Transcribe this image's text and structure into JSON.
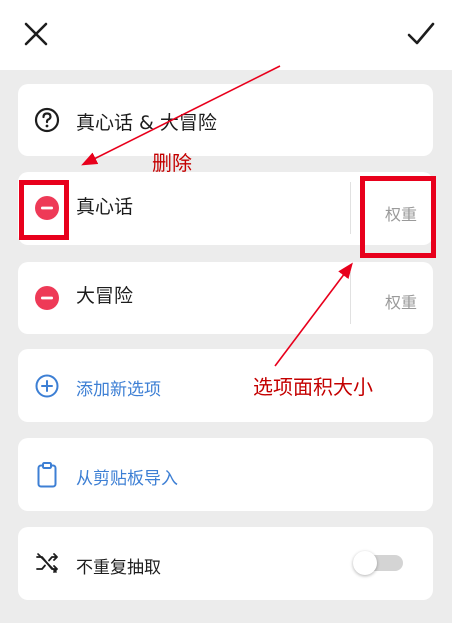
{
  "header": {
    "close_icon": "close-icon",
    "confirm_icon": "check-icon"
  },
  "title_card": {
    "icon": "question-circle-icon",
    "text": "真心话 & 大冒险"
  },
  "options": [
    {
      "label": "真心话",
      "weight_label": "权重",
      "remove_icon": "minus-circle-icon"
    },
    {
      "label": "大冒险",
      "weight_label": "权重",
      "remove_icon": "minus-circle-icon"
    }
  ],
  "actions": {
    "add_option": {
      "label": "添加新选项",
      "icon": "plus-circle-icon"
    },
    "import_clipboard": {
      "label": "从剪贴板导入",
      "icon": "clipboard-icon"
    }
  },
  "no_repeat": {
    "label": "不重复抽取",
    "icon": "shuffle-icon",
    "toggle_on": false
  },
  "annotations": {
    "delete_label": "删除",
    "area_label": "选项面积大小",
    "color": "#e8001c"
  },
  "colors": {
    "accent_blue": "#3d7fd4",
    "remove_red": "#ee3a57",
    "background": "#ececec"
  }
}
